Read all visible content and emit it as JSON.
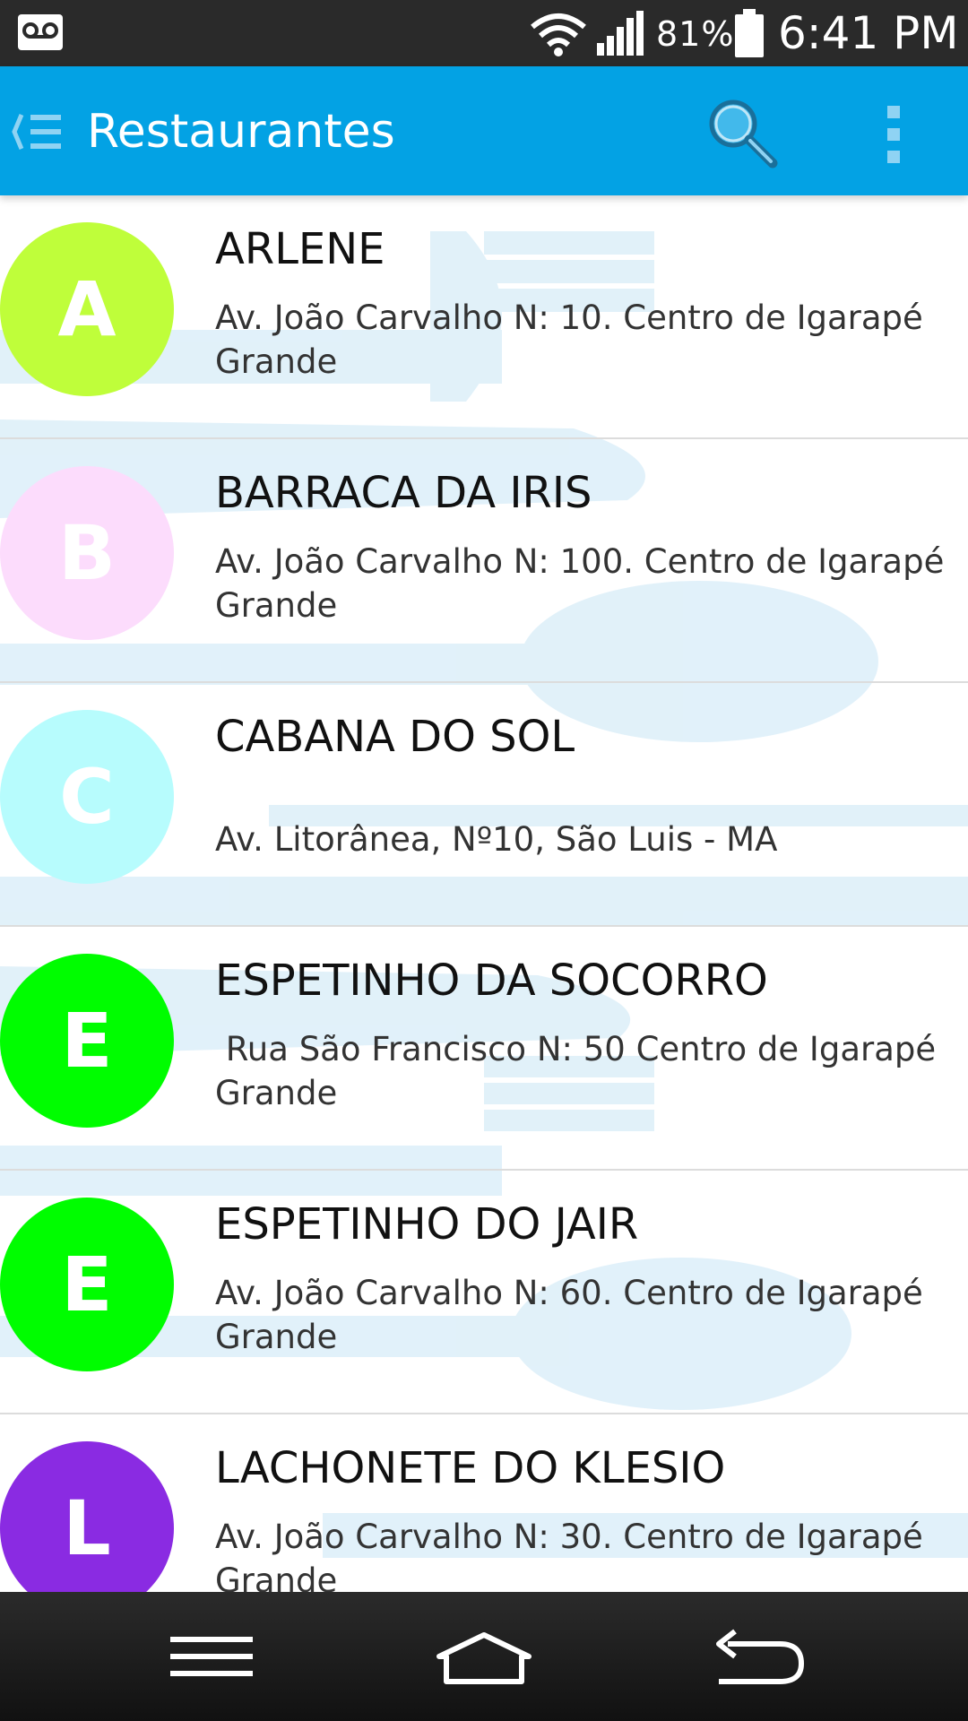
{
  "status_bar": {
    "battery_pct": "81%",
    "time": "6:41 PM",
    "icons": [
      "voicemail-icon",
      "wifi-icon",
      "signal-icon",
      "battery-icon"
    ]
  },
  "app_bar": {
    "title": "Restaurantes",
    "color": "#03a2e4",
    "icons": [
      "drawer-icon",
      "search-icon",
      "overflow-menu-icon"
    ]
  },
  "restaurants": [
    {
      "initial": "A",
      "color": "#bffe3a",
      "name": "ARLENE",
      "address": "Av. João Carvalho N: 10. Centro de Igarapé Grande"
    },
    {
      "initial": "B",
      "color": "#fcdcfc",
      "name": "BARRACA DA IRIS",
      "address": "Av. João Carvalho N: 100. Centro de Igarapé Grande"
    },
    {
      "initial": "C",
      "color": "#b7fcfd",
      "name": "CABANA DO SOL",
      "address": "Av. Litorânea, Nº10, São Luis - MA"
    },
    {
      "initial": "E",
      "color": "#00fd00",
      "name": "ESPETINHO DA SOCORRO",
      "address": " Rua São Francisco N: 50 Centro de Igarapé Grande"
    },
    {
      "initial": "E",
      "color": "#00fd00",
      "name": "ESPETINHO DO JAIR",
      "address": "Av. João Carvalho N: 60. Centro de Igarapé Grande"
    },
    {
      "initial": "L",
      "color": "#8a2be2",
      "name": "LACHONETE DO KLESIO",
      "address": "Av. João Carvalho N: 30. Centro de Igarapé Grande"
    }
  ],
  "nav_bar": {
    "icons": [
      "menu-icon",
      "home-icon",
      "back-icon"
    ]
  }
}
